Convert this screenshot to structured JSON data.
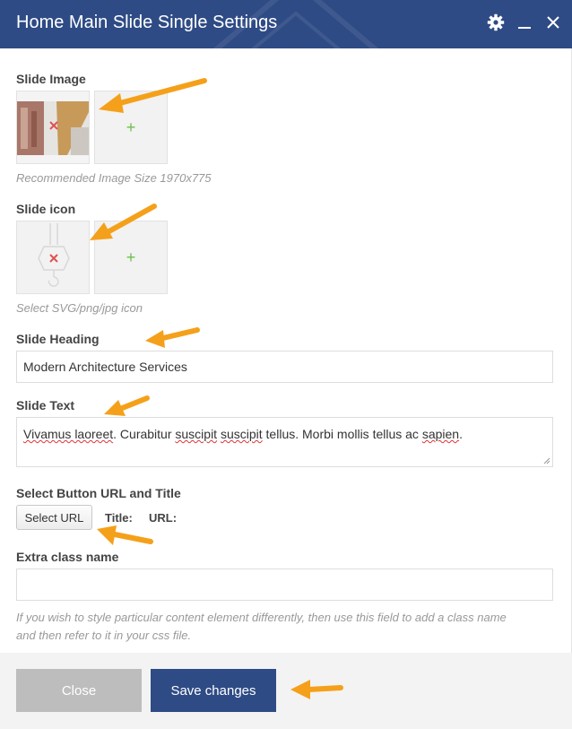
{
  "window": {
    "title": "Home Main Slide Single Settings",
    "icons": [
      "gear-icon",
      "minimize-icon",
      "close-icon"
    ]
  },
  "slide_image": {
    "label": "Slide Image",
    "add_symbol": "+",
    "hint": "Recommended Image Size 1970x775"
  },
  "slide_icon": {
    "label": "Slide icon",
    "add_symbol": "+",
    "hint": "Select SVG/png/jpg icon"
  },
  "slide_heading": {
    "label": "Slide Heading",
    "value": "Modern Architecture Services"
  },
  "slide_text": {
    "label": "Slide Text",
    "value_parts": [
      "Vivamus laoreet",
      ". Curabitur ",
      "suscipit",
      " ",
      "suscipit",
      " tellus. Morbi mollis tellus ac ",
      "sapien",
      "."
    ]
  },
  "button_url": {
    "label": "Select Button URL and Title",
    "button_label": "Select URL",
    "title_label": "Title:",
    "url_label": "URL:"
  },
  "extra_class": {
    "label": "Extra class name",
    "value": "",
    "hint_line1": "If you wish to style particular content element differently, then use this field to add a class name",
    "hint_line2": "and then refer to it in your css file."
  },
  "footer": {
    "close_label": "Close",
    "save_label": "Save changes"
  },
  "colors": {
    "header_bg": "#2e4b85",
    "accent_arrow": "#f5a01a",
    "add_plus": "#6cc04a",
    "remove_x": "#e05252"
  }
}
